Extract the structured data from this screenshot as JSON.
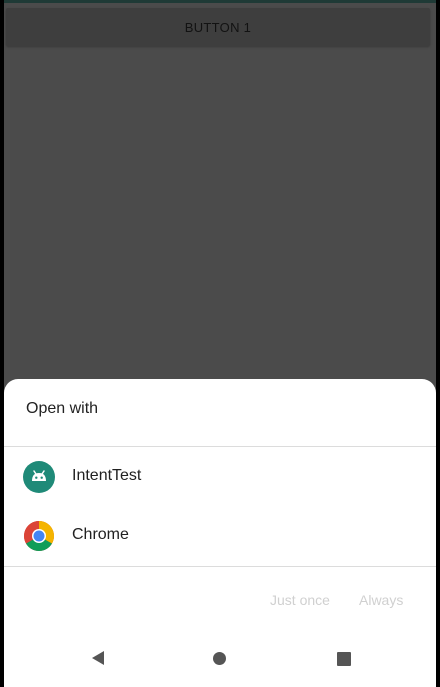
{
  "app": {
    "button1_label": "BUTTON 1"
  },
  "chooser": {
    "title": "Open with",
    "items": [
      {
        "label": "IntentTest",
        "icon": "android-app-icon"
      },
      {
        "label": "Chrome",
        "icon": "chrome-icon"
      }
    ],
    "actions": {
      "just_once": "Just once",
      "always": "Always"
    }
  },
  "nav": {
    "back": "back-icon",
    "home": "home-icon",
    "recents": "recents-icon"
  },
  "colors": {
    "app_background": "#4b4b4b",
    "sheet_background": "#ffffff",
    "android_green": "#3ddc84",
    "disabled_text": "#d0d0d0"
  }
}
